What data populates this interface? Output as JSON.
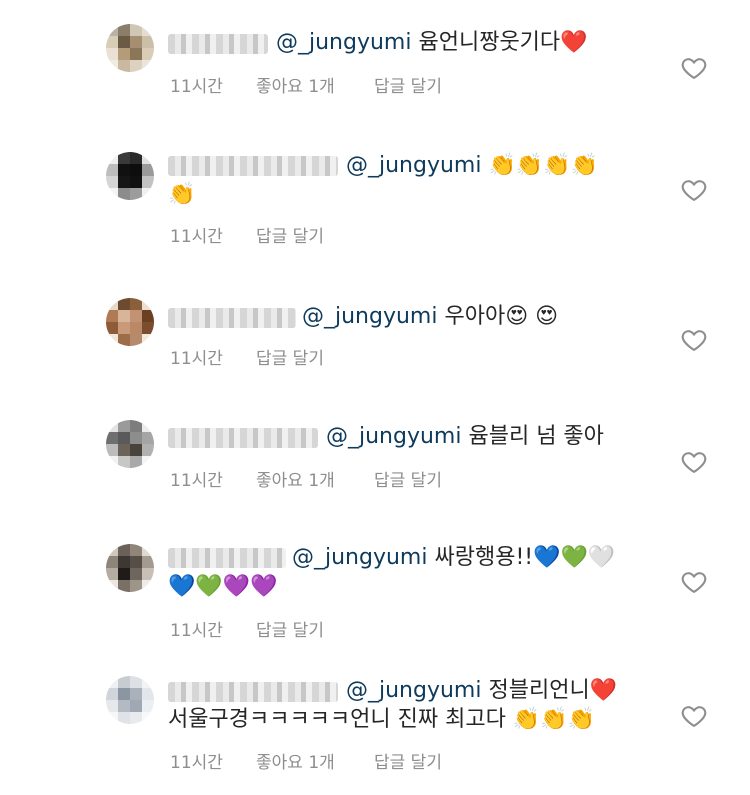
{
  "comments": [
    {
      "mention": "@_jungyumi",
      "line1": "윰언니짱웃기다❤️",
      "line2": "",
      "time": "11시간",
      "likes": "좋아요 1개",
      "reply": "답글 달기"
    },
    {
      "mention": "@_jungyumi",
      "line1": "👏👏👏👏",
      "line2": "👏",
      "time": "11시간",
      "likes": "",
      "reply": "답글 달기"
    },
    {
      "mention": "@_jungyumi",
      "line1": "우아아😍 😍",
      "line2": "",
      "time": "11시간",
      "likes": "",
      "reply": "답글 달기"
    },
    {
      "mention": "@_jungyumi",
      "line1": "윰블리 넘 좋아",
      "line2": "",
      "time": "11시간",
      "likes": "좋아요 1개",
      "reply": "답글 달기"
    },
    {
      "mention": "@_jungyumi",
      "line1": "싸랑행용!!💙💚🤍",
      "line2": "💙💚💜💜",
      "time": "11시간",
      "likes": "",
      "reply": "답글 달기"
    },
    {
      "mention": "@_jungyumi",
      "line1": "정블리언니❤️",
      "line2": "서울구경ㅋㅋㅋㅋㅋ언니 진짜 최고다 👏👏👏",
      "time": "11시간",
      "likes": "좋아요 1개",
      "reply": "답글 달기"
    }
  ],
  "icons": {
    "like": "heart-outline-icon"
  },
  "colors": {
    "mention": "#0e3a5b",
    "meta": "#8e8e8e",
    "text": "#262626"
  }
}
